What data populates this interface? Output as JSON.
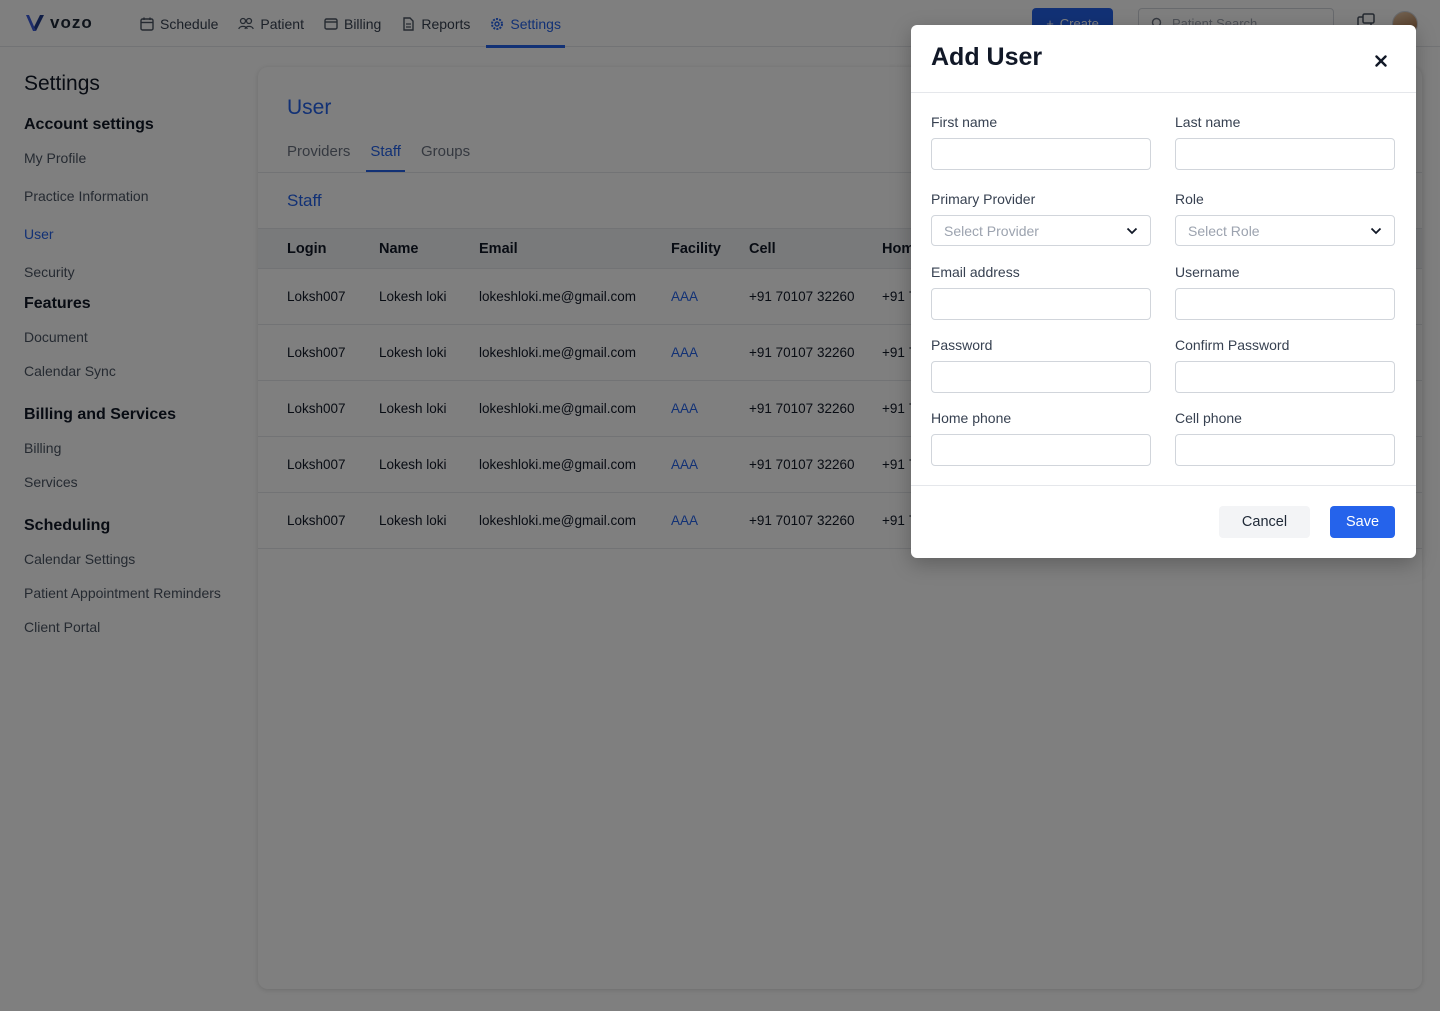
{
  "app": {
    "logo_text": "vozo"
  },
  "nav": {
    "items": [
      {
        "label": "Schedule",
        "icon": "calendar-icon"
      },
      {
        "label": "Patient",
        "icon": "users-icon"
      },
      {
        "label": "Billing",
        "icon": "billing-icon"
      },
      {
        "label": "Reports",
        "icon": "report-icon"
      },
      {
        "label": "Settings",
        "icon": "gear-icon",
        "active": true
      }
    ],
    "create_label": "Create",
    "search_placeholder": "Patient Search"
  },
  "sidebar": {
    "title": "Settings",
    "sections": [
      {
        "heading": "Account settings",
        "items": [
          "My Profile",
          "Practice Information",
          "User",
          "Security"
        ]
      },
      {
        "heading": "Features",
        "items": [
          "Document",
          "Calendar Sync"
        ]
      },
      {
        "heading": "Billing and Services",
        "items": [
          "Billing",
          "Services"
        ]
      },
      {
        "heading": "Scheduling",
        "items": [
          "Calendar Settings",
          "Patient Appointment Reminders",
          "Client Portal"
        ]
      }
    ],
    "active_item": "User"
  },
  "main": {
    "title": "User",
    "tabs": [
      "Providers",
      "Staff",
      "Groups"
    ],
    "active_tab": "Staff",
    "section_title": "Staff",
    "table": {
      "headers": [
        "Login",
        "Name",
        "Email",
        "Facility",
        "Cell",
        "Hom"
      ],
      "rows": [
        [
          "Loksh007",
          "Lokesh loki",
          "lokeshloki.me@gmail.com",
          "AAA",
          "+91 70107 32260",
          "+91 7"
        ],
        [
          "Loksh007",
          "Lokesh loki",
          "lokeshloki.me@gmail.com",
          "AAA",
          "+91 70107 32260",
          "+91 7"
        ],
        [
          "Loksh007",
          "Lokesh loki",
          "lokeshloki.me@gmail.com",
          "AAA",
          "+91 70107 32260",
          "+91 7"
        ],
        [
          "Loksh007",
          "Lokesh loki",
          "lokeshloki.me@gmail.com",
          "AAA",
          "+91 70107 32260",
          "+91 7"
        ],
        [
          "Loksh007",
          "Lokesh loki",
          "lokeshloki.me@gmail.com",
          "AAA",
          "+91 70107 32260",
          "+91 7"
        ]
      ]
    }
  },
  "modal": {
    "title": "Add User",
    "fields": {
      "first_name": {
        "label": "First name",
        "value": ""
      },
      "last_name": {
        "label": "Last name",
        "value": ""
      },
      "primary_provider": {
        "label": "Primary Provider",
        "placeholder": "Select Provider"
      },
      "role": {
        "label": "Role",
        "placeholder": "Select Role"
      },
      "email": {
        "label": "Email address",
        "value": ""
      },
      "username": {
        "label": "Username",
        "value": ""
      },
      "password": {
        "label": "Password",
        "value": ""
      },
      "confirm_password": {
        "label": "Confirm Password",
        "value": ""
      },
      "home_phone": {
        "label": "Home phone",
        "value": ""
      },
      "cell_phone": {
        "label": "Cell phone",
        "value": ""
      }
    },
    "cancel_label": "Cancel",
    "save_label": "Save"
  },
  "colors": {
    "accent": "#2563eb",
    "overlay": "rgba(0,0,0,0.5)"
  }
}
